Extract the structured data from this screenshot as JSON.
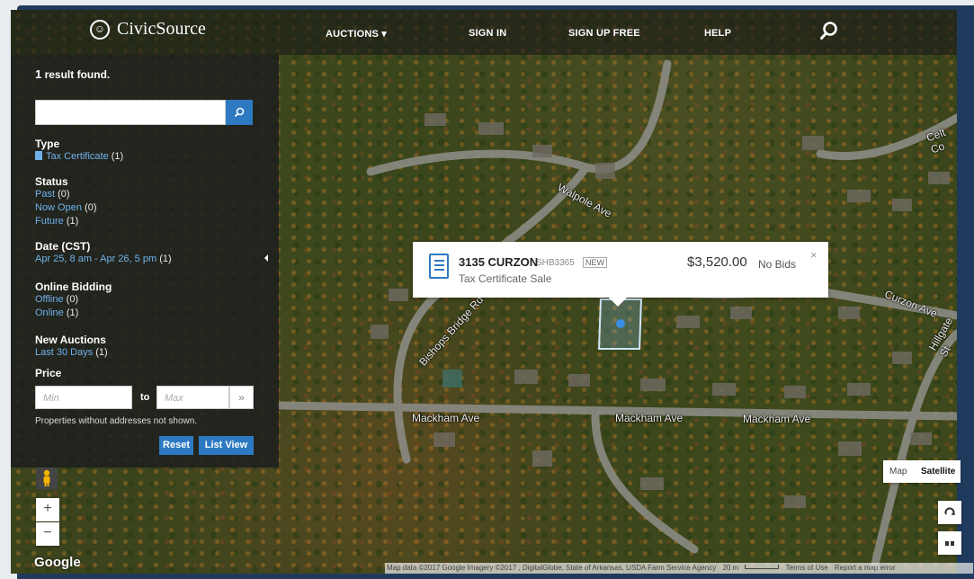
{
  "header": {
    "logo_text": "CivicSource",
    "nav": [
      "AUCTIONS ▾",
      "SIGN IN",
      "SIGN UP FREE",
      "HELP"
    ]
  },
  "filters": {
    "results_count": "1",
    "results_label": "result found.",
    "search_placeholder": "",
    "type": {
      "heading": "Type",
      "items": [
        {
          "label": "Tax Certificate",
          "count": "(1)"
        }
      ]
    },
    "status": {
      "heading": "Status",
      "items": [
        {
          "label": "Past",
          "count": "(0)"
        },
        {
          "label": "Now Open",
          "count": "(0)"
        },
        {
          "label": "Future",
          "count": "(1)"
        }
      ]
    },
    "date": {
      "heading": "Date (CST)",
      "items": [
        {
          "label": "Apr 25, 8 am - Apr 26, 5 pm",
          "count": "(1)"
        }
      ]
    },
    "bidding": {
      "heading": "Online Bidding",
      "items": [
        {
          "label": "Offline",
          "count": "(0)"
        },
        {
          "label": "Online",
          "count": "(1)"
        }
      ]
    },
    "new": {
      "heading": "New Auctions",
      "items": [
        {
          "label": "Last 30 Days",
          "count": "(1)"
        }
      ]
    },
    "price": {
      "heading": "Price",
      "min_placeholder": "Min",
      "to_label": "to",
      "max_placeholder": "Max",
      "go": "»"
    },
    "note": "Properties without addresses not shown.",
    "reset_label": "Reset",
    "list_view_label": "List View"
  },
  "popup": {
    "address": "3135 CURZON",
    "code": "SHB3365",
    "badge": "NEW",
    "type": "Tax Certificate Sale",
    "price": "$3,520.00",
    "bids": "No Bids",
    "close": "×"
  },
  "map": {
    "streets": [
      "Walpole Ave",
      "Bishops Bridge Rd",
      "Mackham Ave",
      "Mackham Ave",
      "Mackham Ave",
      "Curzon Ave",
      "Hillgate St",
      "Celt Co"
    ],
    "map_type": [
      "Map",
      "Satellite"
    ],
    "zoom_in": "+",
    "zoom_out": "−",
    "google": "Google",
    "attribution": [
      "Map data ©2017 Google Imagery ©2017 , DigitalGlobe, State of Arkansas, USDA Farm Service Agency",
      "20 m",
      "Terms of Use",
      "Report a map error"
    ]
  }
}
